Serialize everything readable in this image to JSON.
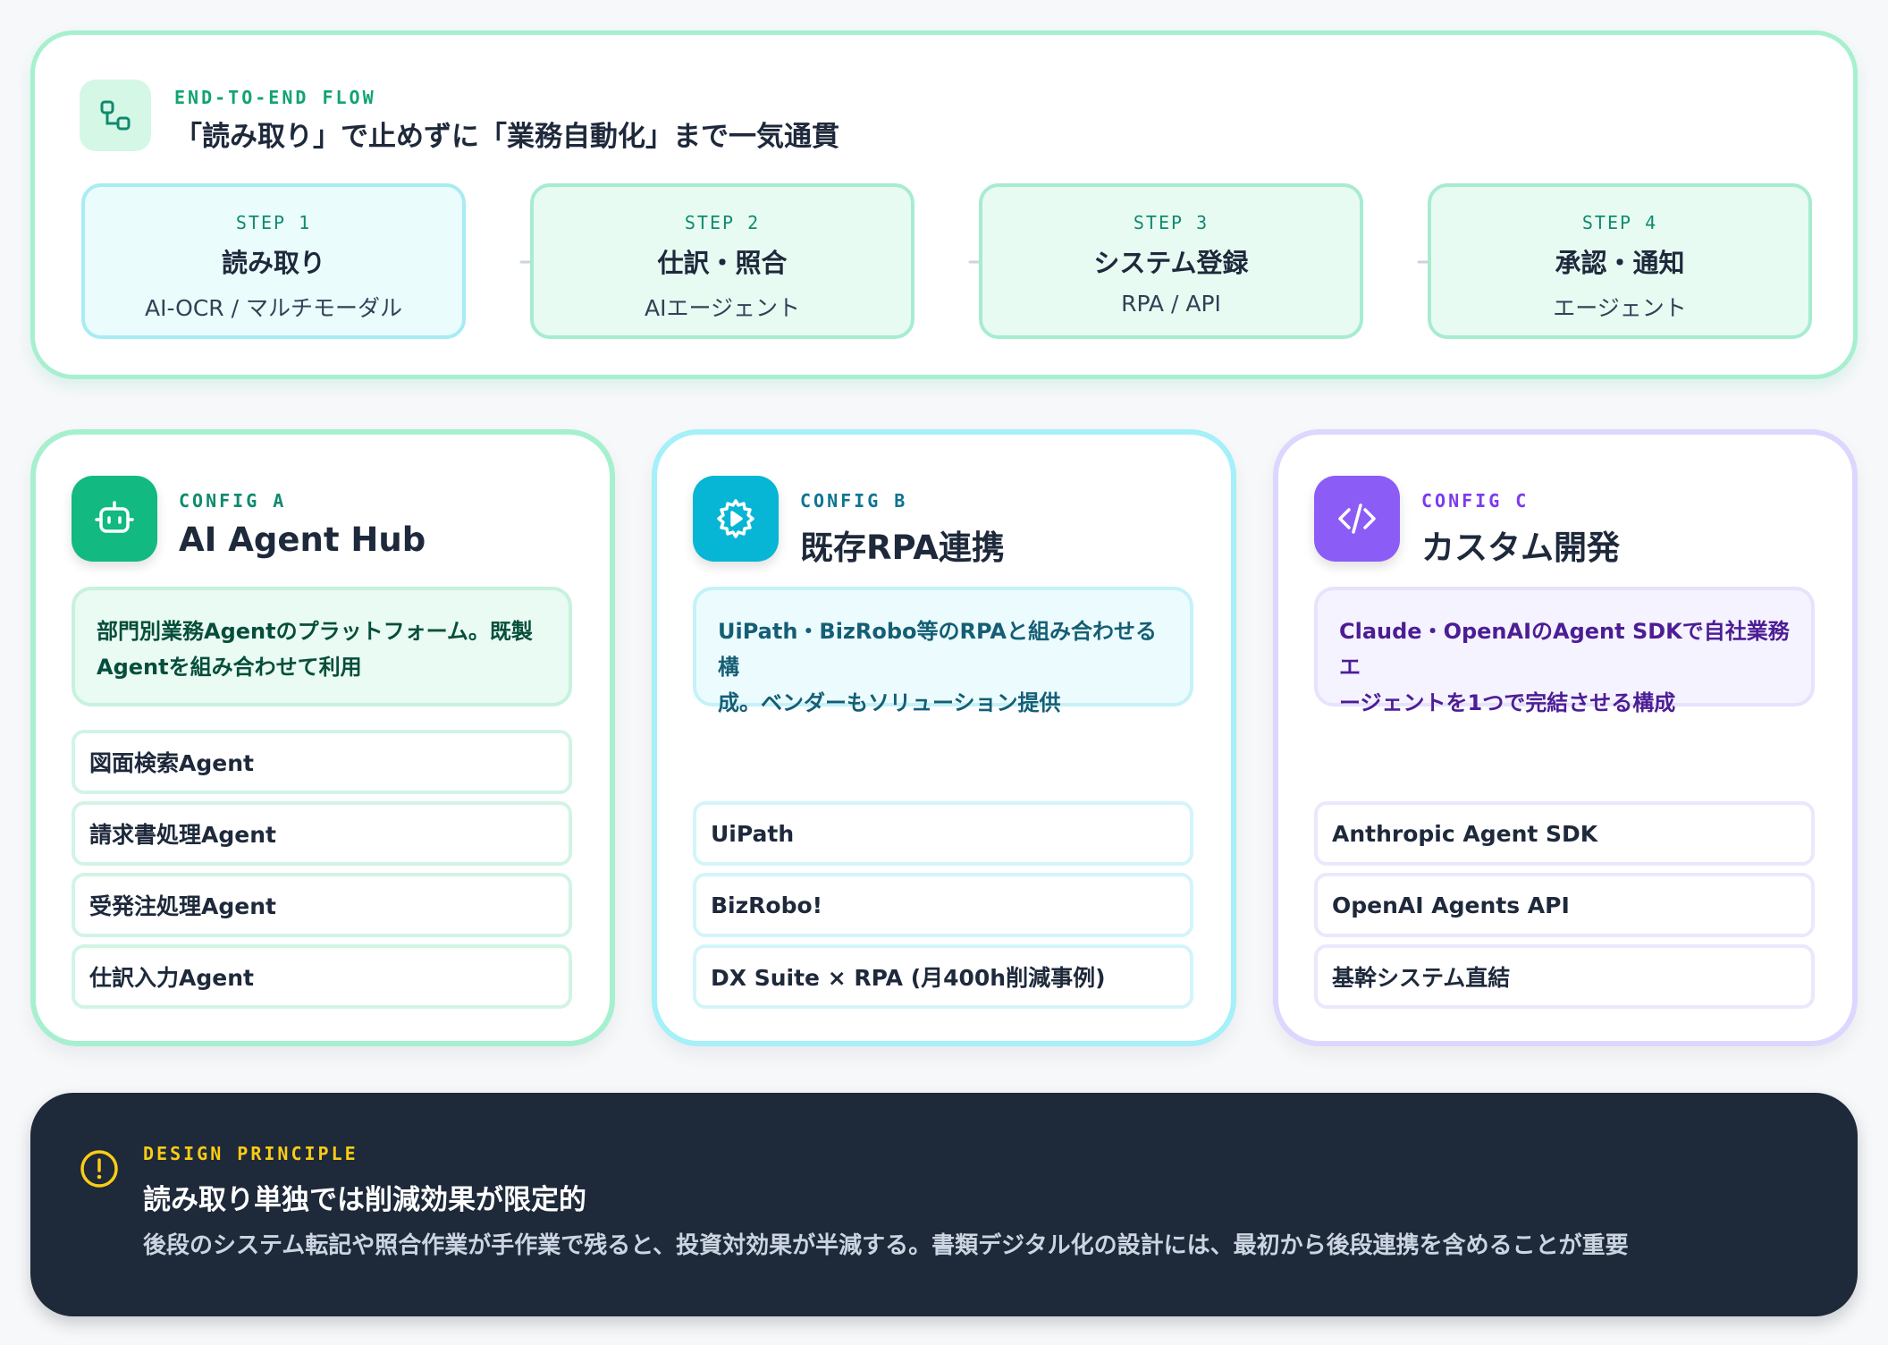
{
  "flow": {
    "eyebrow": "END-TO-END FLOW",
    "title": "「読み取り」で止めずに「業務自動化」まで一気通貫",
    "icon": "flow-nodes-icon",
    "steps": [
      {
        "label": "STEP 1",
        "name": "読み取り",
        "sub": "AI-OCR / マルチモーダル"
      },
      {
        "label": "STEP 2",
        "name": "仕訳・照合",
        "sub": "AIエージェント"
      },
      {
        "label": "STEP 3",
        "name": "システム登録",
        "sub": "RPA / API"
      },
      {
        "label": "STEP 4",
        "name": "承認・通知",
        "sub": "エージェント"
      }
    ]
  },
  "configs": [
    {
      "eyebrow": "CONFIG A",
      "title": "AI Agent Hub",
      "icon": "robot-icon",
      "accent": "#12b981",
      "desc_line1": "部門別業務Agentのプラットフォーム。既製",
      "desc_line2": "Agentを組み合わせて利用",
      "items": [
        "図面検索Agent",
        "請求書処理Agent",
        "受発注処理Agent",
        "仕訳入力Agent"
      ]
    },
    {
      "eyebrow": "CONFIG B",
      "title": "既存RPA連携",
      "icon": "gear-play-icon",
      "accent": "#06b6d4",
      "desc_line1": "UiPath・BizRobo等のRPAと組み合わせる構",
      "desc_line2": "成。ベンダーもソリューション提供",
      "items": [
        "UiPath",
        "BizRobo!",
        "DX Suite × RPA (月400h削減事例)"
      ]
    },
    {
      "eyebrow": "CONFIG C",
      "title": "カスタム開発",
      "icon": "code-icon",
      "accent": "#8b5cf6",
      "desc_line1": "Claude・OpenAIのAgent SDKで自社業務エ",
      "desc_line2": "ージェントを1つで完結させる構成",
      "items": [
        "Anthropic Agent SDK",
        "OpenAI Agents API",
        "基幹システム直結"
      ]
    }
  ],
  "principle": {
    "eyebrow": "DESIGN PRINCIPLE",
    "title": "読み取り単独では削減効果が限定的",
    "body": "後段のシステム転記や照合作業が手作業で残ると、投資対効果が半減する。書類デジタル化の設計には、最初から後段連携を含めることが重要",
    "icon": "alert-circle-icon",
    "accent": "#facc15"
  }
}
